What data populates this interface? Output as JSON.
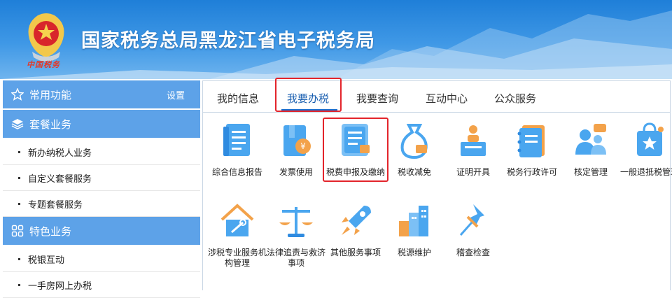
{
  "header": {
    "site_title": "国家税务总局黑龙江省电子税务局",
    "emblem_caption": "中国税务"
  },
  "sidebar": {
    "sections": [
      {
        "icon": "star-icon",
        "title": "常用功能",
        "extra": "设置",
        "items": []
      },
      {
        "icon": "layers-icon",
        "title": "套餐业务",
        "items": [
          "新办纳税人业务",
          "自定义套餐服务",
          "专题套餐服务"
        ]
      },
      {
        "icon": "grid-icon",
        "title": "特色业务",
        "items": [
          "税银互动",
          "一手房网上办税"
        ]
      }
    ]
  },
  "tabs": [
    {
      "label": "我的信息",
      "active": false
    },
    {
      "label": "我要办税",
      "active": true
    },
    {
      "label": "我要查询",
      "active": false
    },
    {
      "label": "互动中心",
      "active": false
    },
    {
      "label": "公众服务",
      "active": false
    }
  ],
  "services_row1": [
    {
      "label": "综合信息报告",
      "icon": "report-document-icon"
    },
    {
      "label": "发票使用",
      "icon": "invoice-icon"
    },
    {
      "label": "税费申报及缴纳",
      "icon": "tax-declaration-icon",
      "highlighted": true
    },
    {
      "label": "税收减免",
      "icon": "money-bag-icon"
    },
    {
      "label": "证明开具",
      "icon": "certificate-person-icon"
    },
    {
      "label": "税务行政许可",
      "icon": "notebook-icon"
    },
    {
      "label": "核定管理",
      "icon": "users-chat-icon"
    },
    {
      "label": "一般退抵税管理",
      "icon": "shopping-bag-star-icon"
    }
  ],
  "services_row2": [
    {
      "label": "涉税专业服务机构管理",
      "icon": "house-tools-icon"
    },
    {
      "label": "法律追责与救济事项",
      "icon": "scales-icon"
    },
    {
      "label": "其他服务事项",
      "icon": "rocket-icon"
    },
    {
      "label": "税源维护",
      "icon": "buildings-icon"
    },
    {
      "label": "稽查检查",
      "icon": "pin-icon"
    }
  ],
  "colors": {
    "brand_blue": "#2f8be0",
    "sidebar_header": "#5da2e8",
    "highlight_red": "#e3242b",
    "icon_blue": "#4aa6ef",
    "icon_orange": "#f3a24a"
  }
}
